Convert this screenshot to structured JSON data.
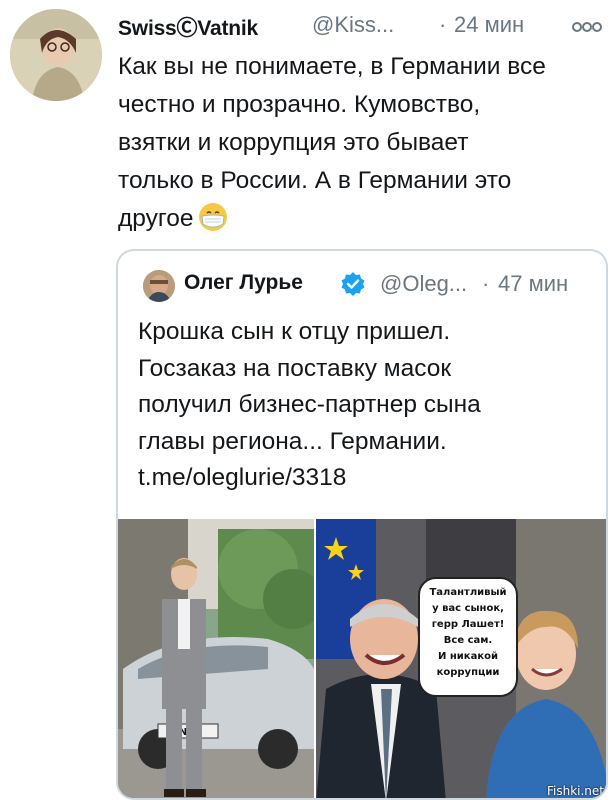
{
  "tweet": {
    "author_name": "SwissⒸVatnik",
    "author_handle": "@Kiss...",
    "separator": "·",
    "timestamp": "24 мин",
    "text_lines": [
      "Как вы не понимаете, в Германии все",
      "честно и прозрачно. Кумовство,",
      "взятки и коррупция это бывает",
      "только в России. А в Германии это",
      "другое"
    ],
    "emoji": "face-with-medical-mask"
  },
  "quote": {
    "author_name": "Олег Лурье",
    "author_handle": "@Oleg...",
    "separator": "·",
    "timestamp": "47 мин",
    "text_lines": [
      "Крошка сын к отцу пришел.",
      "Госзаказ на поставку масок",
      "получил бизнес-партнер сына",
      "главы региона... Германии.",
      "t.me/oleglurie/3318"
    ],
    "image": {
      "bubble_lines": [
        "Талантливый",
        "у вас сынок,",
        "герр Лашет!",
        "Все сам.",
        "И никакой",
        "коррупции"
      ],
      "plate_text": "NM"
    }
  },
  "watermark": "Fishki.net",
  "colors": {
    "text": "#14171a",
    "secondary": "#6b7780",
    "border": "#cfd8de",
    "verified": "#1da1f2"
  }
}
